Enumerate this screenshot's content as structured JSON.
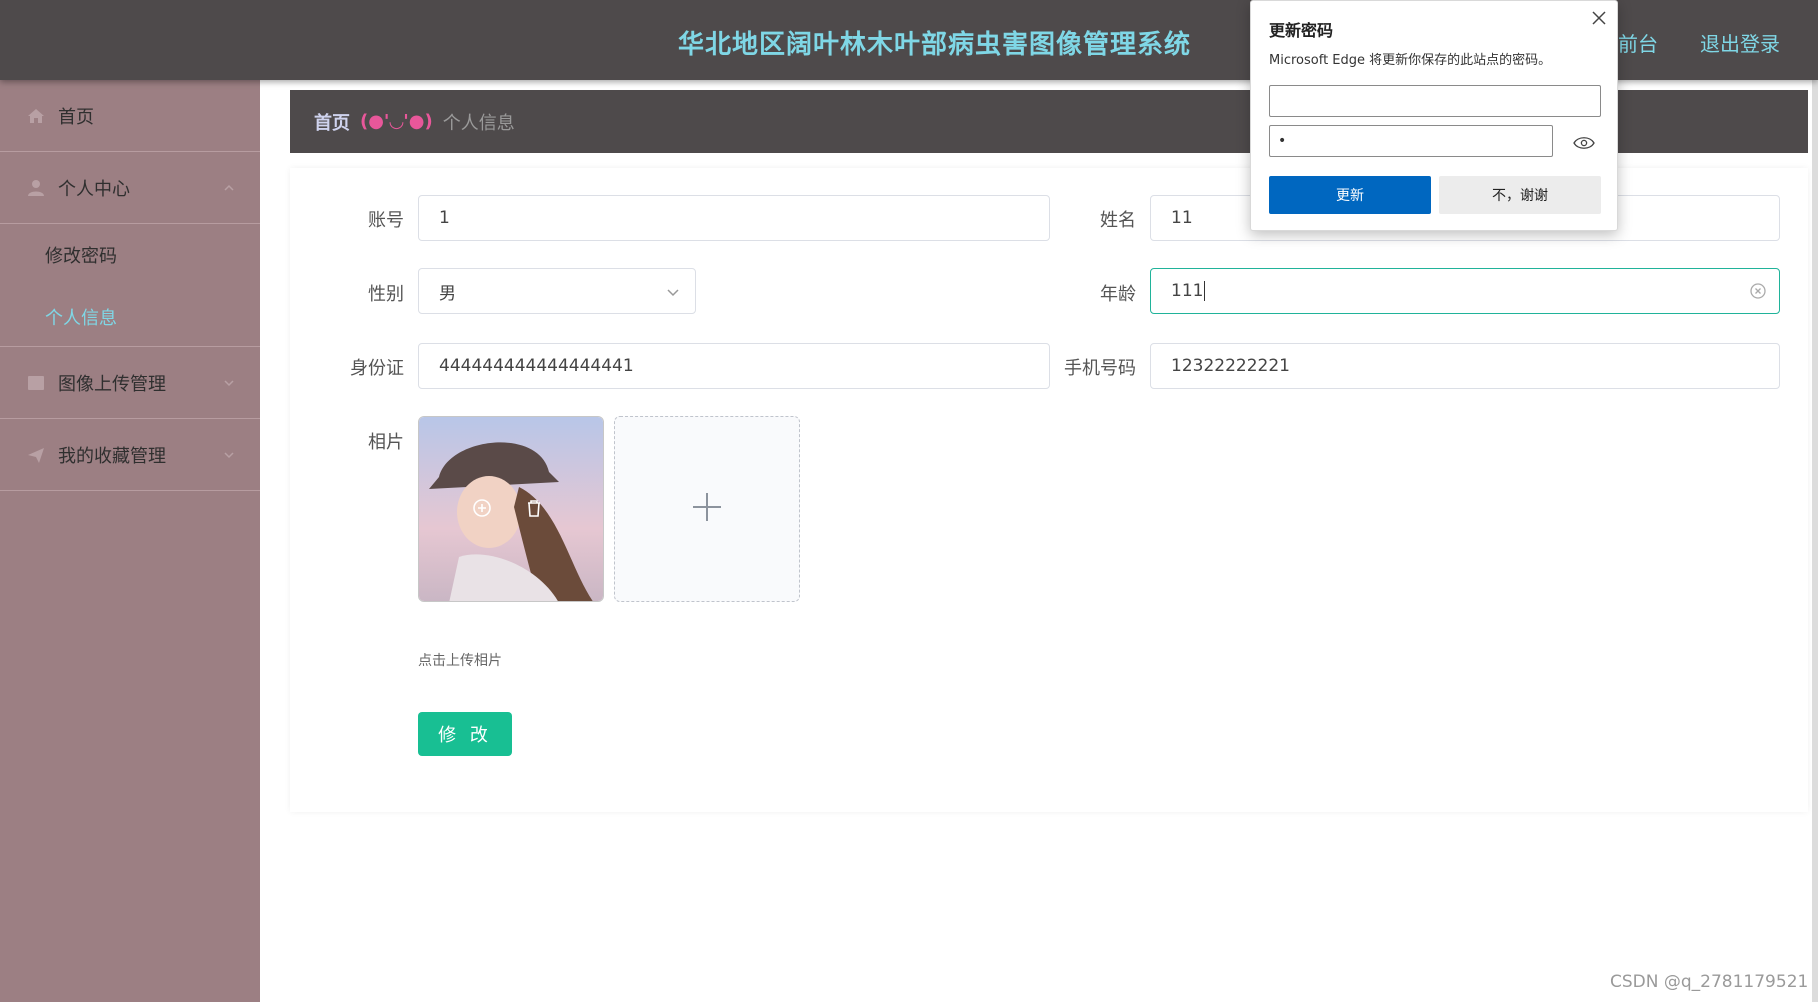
{
  "header": {
    "title": "华北地区阔叶林木叶部病虫害图像管理系统",
    "nav_front": "到前台",
    "nav_logout": "退出登录"
  },
  "sidebar": {
    "items": [
      {
        "label": "首页",
        "icon": "home-icon"
      },
      {
        "label": "个人中心",
        "icon": "user-icon",
        "expanded": true,
        "children": [
          {
            "label": "修改密码"
          },
          {
            "label": "个人信息",
            "active": true
          }
        ]
      },
      {
        "label": "图像上传管理",
        "icon": "image-icon",
        "expanded": false
      },
      {
        "label": "我的收藏管理",
        "icon": "send-icon",
        "expanded": false
      }
    ]
  },
  "breadcrumb": {
    "home": "首页",
    "separator": "(●'◡'●)",
    "current": "个人信息"
  },
  "form": {
    "account": {
      "label": "账号",
      "value": "1"
    },
    "name": {
      "label": "姓名",
      "value": "11"
    },
    "gender": {
      "label": "性别",
      "value": "男"
    },
    "age": {
      "label": "年龄",
      "value": "111"
    },
    "id_card": {
      "label": "身份证",
      "value": "444444444444444441"
    },
    "phone": {
      "label": "手机号码",
      "value": "12322222221"
    },
    "photo": {
      "label": "相片",
      "hint": "点击上传相片"
    },
    "submit_label": "修 改"
  },
  "password_popup": {
    "title": "更新密码",
    "description": "Microsoft Edge 将更新你保存的此站点的密码。",
    "username_value": "",
    "password_value": "•",
    "update_label": "更新",
    "decline_label": "不，谢谢"
  },
  "watermark": "CSDN @q_2781179521",
  "colors": {
    "header_bg": "#4e4a4b",
    "sidebar_bg": "#9c7f83",
    "accent_cyan": "#7fd7e6",
    "submit_green": "#18bf93",
    "edge_blue": "#0067c0"
  }
}
